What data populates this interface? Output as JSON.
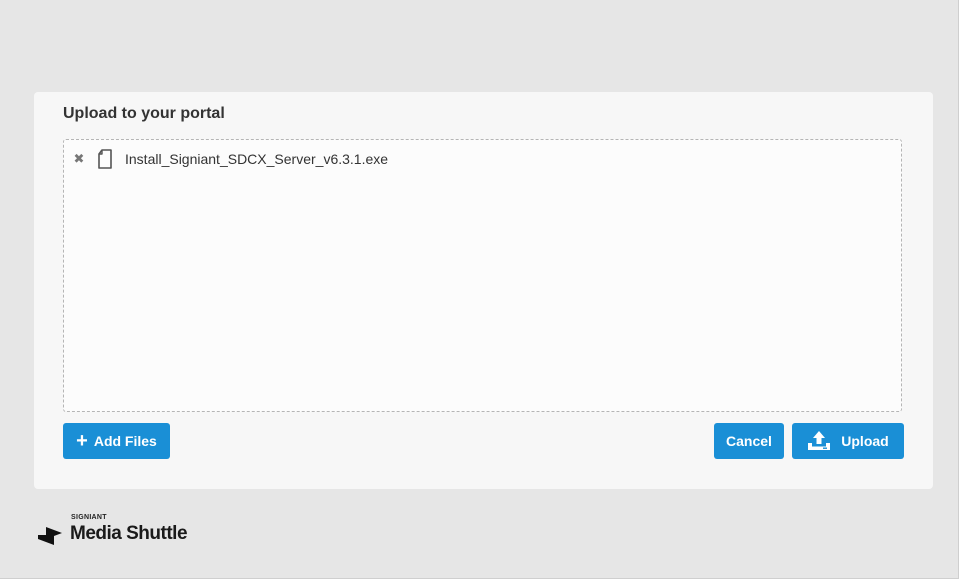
{
  "panel": {
    "title": "Upload to your portal"
  },
  "files": [
    {
      "name": "Install_Signiant_SDCX_Server_v6.3.1.exe",
      "remove_icon": "close-icon",
      "file_icon": "file-icon"
    }
  ],
  "actions": {
    "add_files_label": "Add Files",
    "add_icon": "plus-icon",
    "cancel_label": "Cancel",
    "upload_label": "Upload",
    "upload_icon": "upload-tray-icon"
  },
  "branding": {
    "company": "SIGNIANT",
    "product": "Media Shuttle",
    "logo_icon": "swap-arrows-icon"
  },
  "colors": {
    "accent": "#1a8fd6",
    "background": "#e6e6e6",
    "panel": "#f7f7f7"
  }
}
